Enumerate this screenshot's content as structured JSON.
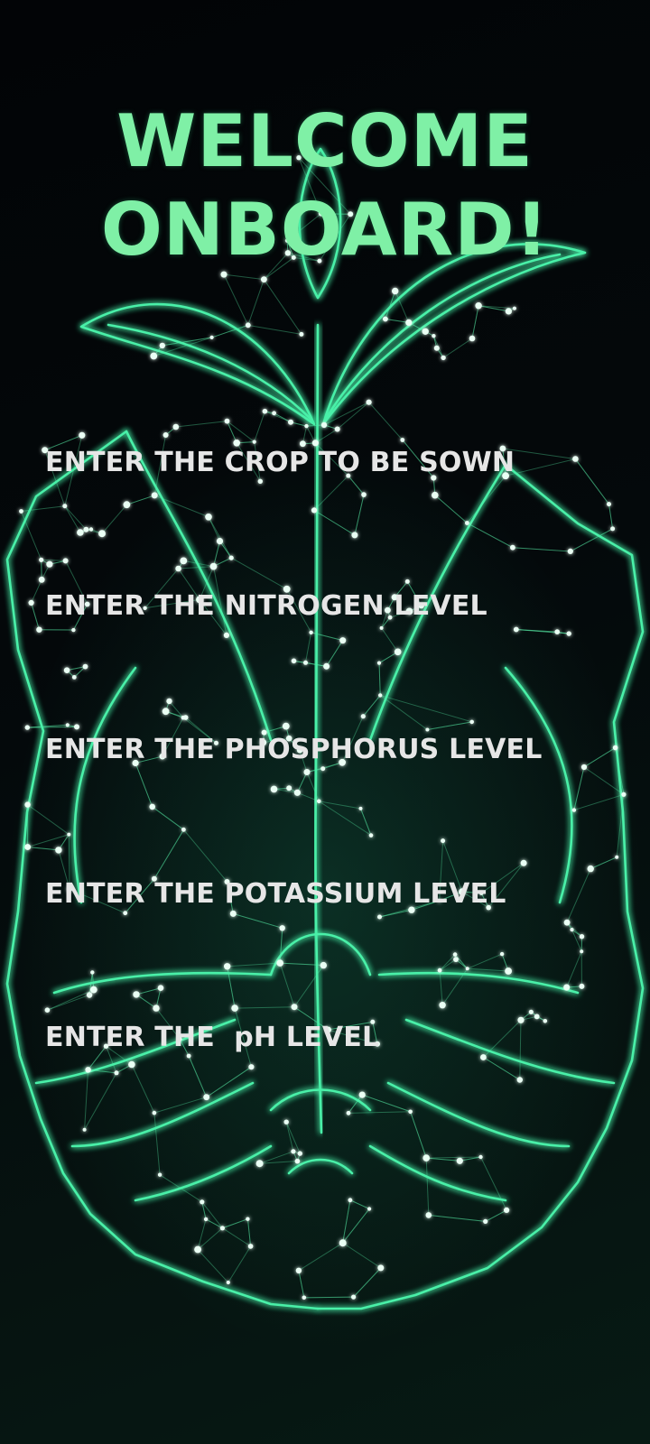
{
  "screen": {
    "title_line1": "WELCOME",
    "title_line2": "ONBOARD!",
    "background_art": "glowing-plant-in-hands-illustration",
    "colors": {
      "title": "#7ff0a6",
      "glow": "#49f0a8",
      "field_text": "#e6e6e6",
      "background": "#03060a"
    }
  },
  "form": {
    "crop_placeholder": "ENTER THE CROP TO BE SOWN",
    "nitrogen_placeholder": "ENTER THE NITROGEN LEVEL",
    "phosphorus_placeholder": "ENTER THE PHOSPHORUS LEVEL",
    "potassium_placeholder": "ENTER THE POTASSIUM LEVEL",
    "ph_placeholder": "ENTER THE  pH LEVEL",
    "crop_value": "",
    "nitrogen_value": "",
    "phosphorus_value": "",
    "potassium_value": "",
    "ph_value": ""
  }
}
